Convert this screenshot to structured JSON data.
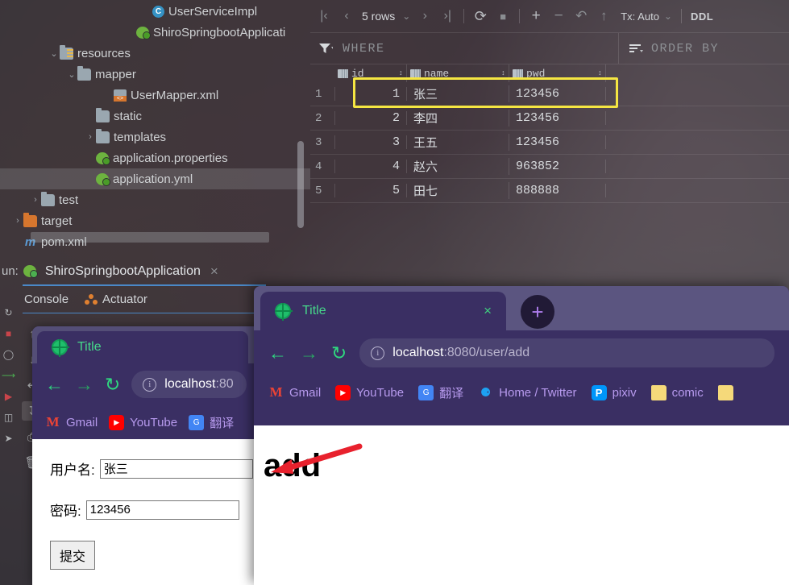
{
  "ide": {
    "project_tree": {
      "items": [
        {
          "label": "UserServiceImpl",
          "icon": "java-class-icon",
          "indent": 175,
          "arrow": "",
          "selected": false
        },
        {
          "label": "ShiroSpringbootApplicati",
          "icon": "spring-boot-icon",
          "indent": 155,
          "arrow": "",
          "selected": false
        },
        {
          "label": "resources",
          "icon": "resources-folder-icon",
          "indent": 60,
          "arrow": "⌄",
          "selected": false
        },
        {
          "label": "mapper",
          "icon": "folder-icon",
          "indent": 82,
          "arrow": "⌄",
          "selected": false
        },
        {
          "label": "UserMapper.xml",
          "icon": "xml-file-icon",
          "indent": 127,
          "arrow": "",
          "selected": false
        },
        {
          "label": "static",
          "icon": "folder-icon",
          "indent": 105,
          "arrow": "",
          "selected": false
        },
        {
          "label": "templates",
          "icon": "folder-icon",
          "indent": 105,
          "arrow": "›",
          "selected": false
        },
        {
          "label": "application.properties",
          "icon": "spring-config-icon",
          "indent": 105,
          "arrow": "",
          "selected": false
        },
        {
          "label": "application.yml",
          "icon": "spring-config-icon",
          "indent": 105,
          "arrow": "",
          "selected": true
        },
        {
          "label": "test",
          "icon": "folder-icon",
          "indent": 37,
          "arrow": "›",
          "selected": false
        },
        {
          "label": "target",
          "icon": "target-folder-icon",
          "indent": 15,
          "arrow": "›",
          "selected": false
        },
        {
          "label": "pom.xml",
          "icon": "maven-icon",
          "indent": 15,
          "arrow": "",
          "selected": false
        }
      ]
    },
    "db_console": {
      "toolbar": {
        "first_page": "|‹",
        "prev_page": "‹",
        "rows_label": "5 rows",
        "rows_chevron": "⌄",
        "next_page": "›",
        "last_page": "›|",
        "reload": "⟳",
        "stop": "■",
        "add_row": "+",
        "delete_row": "−",
        "revert": "↶",
        "submit": "↑",
        "tx_label": "Tx: Auto",
        "tx_chevron": "⌄",
        "ddl_label": "DDL"
      },
      "filter_bar": {
        "filter_icon": "filter-icon",
        "where_label": "WHERE",
        "sort_icon": "sort-icon",
        "orderby_label": "ORDER BY"
      },
      "grid": {
        "columns": [
          {
            "label": "id",
            "icon": "primary-key-icon"
          },
          {
            "label": "name",
            "icon": "column-icon"
          },
          {
            "label": "pwd",
            "icon": "column-icon"
          }
        ],
        "rows": [
          {
            "num": "1",
            "id": "1",
            "name": "张三",
            "pwd": "123456",
            "highlighted": true
          },
          {
            "num": "2",
            "id": "2",
            "name": "李四",
            "pwd": "123456",
            "highlighted": false
          },
          {
            "num": "3",
            "id": "3",
            "name": "王五",
            "pwd": "123456",
            "highlighted": false
          },
          {
            "num": "4",
            "id": "4",
            "name": "赵六",
            "pwd": "963852",
            "highlighted": false
          },
          {
            "num": "5",
            "id": "5",
            "name": "田七",
            "pwd": "888888",
            "highlighted": false
          }
        ],
        "highlight_color": "#f5e642"
      }
    },
    "run_panel": {
      "run_label": "un:",
      "config_name": "ShiroSpringbootApplication",
      "close_icon": "×",
      "tabs": [
        {
          "label": "Console",
          "icon": ""
        },
        {
          "label": "Actuator",
          "icon": "actuator-icon"
        }
      ],
      "tool_buttons": [
        {
          "icon": "arrow-up-icon",
          "glyph": "↑"
        },
        {
          "icon": "arrow-down-icon",
          "glyph": "↓"
        },
        {
          "icon": "soft-wrap-icon",
          "glyph": "↵"
        },
        {
          "icon": "scroll-to-end-icon",
          "glyph": "↧"
        },
        {
          "icon": "print-icon",
          "glyph": "⎙"
        },
        {
          "icon": "trash-icon",
          "glyph": "🗑"
        }
      ]
    },
    "accent_color": "#4a88c7"
  },
  "browser_back": {
    "tab": {
      "title": "Title",
      "favicon": "globe-icon"
    },
    "nav": {
      "back": "←",
      "forward": "→",
      "reload": "↻"
    },
    "url": {
      "prefix": "localhost",
      "suffix": ":80",
      "info_icon": "info-icon"
    },
    "bookmarks": [
      {
        "label": "Gmail",
        "icon": "gmail-icon",
        "glyph": "M"
      },
      {
        "label": "YouTube",
        "icon": "youtube-icon",
        "glyph": "▶"
      },
      {
        "label": "翻译",
        "icon": "google-translate-icon",
        "glyph": "G"
      }
    ],
    "page": {
      "username_label": "用户名:",
      "username_value": "张三",
      "password_label": "密码:",
      "password_value": "123456",
      "submit_label": "提交"
    }
  },
  "browser_front": {
    "tab": {
      "title": "Title",
      "favicon": "globe-icon",
      "close": "×"
    },
    "new_tab": "+",
    "nav": {
      "back": "←",
      "forward": "→",
      "reload": "↻"
    },
    "url": {
      "prefix": "localhost",
      "suffix": ":8080/user/add",
      "info_icon": "info-icon"
    },
    "bookmarks": [
      {
        "label": "Gmail",
        "icon": "gmail-icon",
        "glyph": "M"
      },
      {
        "label": "YouTube",
        "icon": "youtube-icon",
        "glyph": "▶"
      },
      {
        "label": "翻译",
        "icon": "google-translate-icon",
        "glyph": "G"
      },
      {
        "label": "Home / Twitter",
        "icon": "twitter-icon",
        "glyph": "⚈"
      },
      {
        "label": "pixiv",
        "icon": "pixiv-icon",
        "glyph": "P"
      },
      {
        "label": "comic",
        "icon": "bookmark-folder-icon",
        "glyph": ""
      },
      {
        "label": "",
        "icon": "bookmark-folder-icon",
        "glyph": ""
      }
    ],
    "page": {
      "heading": "add"
    }
  },
  "annotation": {
    "arrow_color": "#e8212d",
    "name": "red-arrow-pointing-to-add"
  }
}
